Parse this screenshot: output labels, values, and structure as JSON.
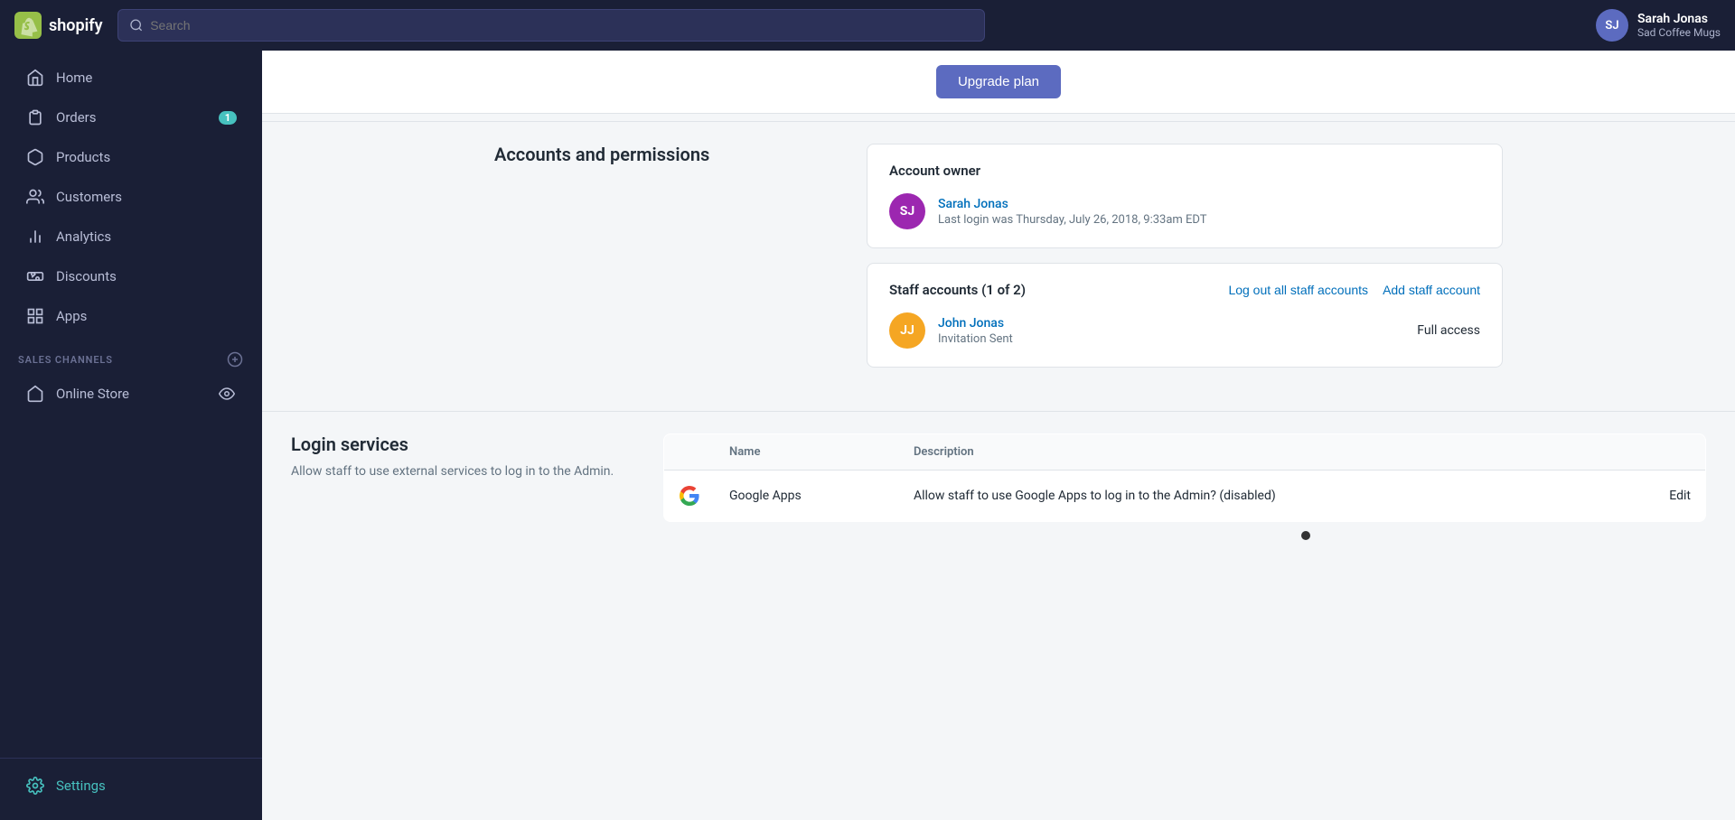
{
  "topnav": {
    "logo_text": "shopify",
    "search_placeholder": "Search"
  },
  "user": {
    "name": "Sarah Jonas",
    "store": "Sad Coffee Mugs",
    "initials": "SJ"
  },
  "sidebar": {
    "items": [
      {
        "id": "home",
        "label": "Home",
        "icon": "home-icon",
        "badge": null
      },
      {
        "id": "orders",
        "label": "Orders",
        "icon": "orders-icon",
        "badge": "1"
      },
      {
        "id": "products",
        "label": "Products",
        "icon": "products-icon",
        "badge": null
      },
      {
        "id": "customers",
        "label": "Customers",
        "icon": "customers-icon",
        "badge": null
      },
      {
        "id": "analytics",
        "label": "Analytics",
        "icon": "analytics-icon",
        "badge": null
      },
      {
        "id": "discounts",
        "label": "Discounts",
        "icon": "discounts-icon",
        "badge": null
      },
      {
        "id": "apps",
        "label": "Apps",
        "icon": "apps-icon",
        "badge": null
      }
    ],
    "sales_channels_label": "SALES CHANNELS",
    "sales_channels": [
      {
        "id": "online-store",
        "label": "Online Store"
      }
    ],
    "settings_label": "Settings"
  },
  "main": {
    "upgrade_btn": "Upgrade plan",
    "accounts_section": {
      "title": "Accounts and permissions",
      "account_owner": {
        "label": "Account owner",
        "name": "Sarah Jonas",
        "initials": "SJ",
        "last_login": "Last login was Thursday, July 26, 2018, 9:33am EDT"
      },
      "staff_accounts": {
        "title": "Staff accounts (1 of 2)",
        "log_out_all": "Log out all staff accounts",
        "add_staff": "Add staff account",
        "staff": [
          {
            "name": "John Jonas",
            "initials": "JJ",
            "status": "Invitation Sent",
            "access": "Full access"
          }
        ]
      }
    },
    "login_services": {
      "title": "Login services",
      "description": "Allow staff to use external services to log in to the Admin.",
      "table": {
        "col_name": "Name",
        "col_description": "Description",
        "rows": [
          {
            "logo": "G",
            "name": "Google Apps",
            "description": "Allow staff to use Google Apps to log in to the Admin? (disabled)",
            "action": "Edit"
          }
        ]
      }
    }
  }
}
